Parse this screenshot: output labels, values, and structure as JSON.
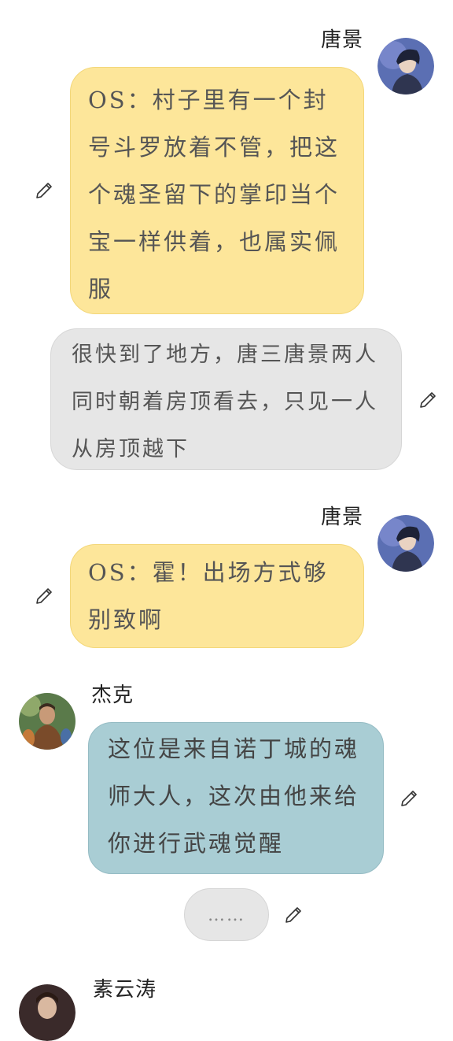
{
  "messages": [
    {
      "speaker": "唐景",
      "text": "OS：村子里有一个封号斗罗放着不管，把这个魂圣留下的掌印当个宝一样供着，也属实佩服",
      "style": "thought"
    },
    {
      "speaker": "",
      "text": "很快到了地方，唐三唐景两人同时朝着房顶看去，只见一人从房顶越下",
      "style": "narration"
    },
    {
      "speaker": "唐景",
      "text": "OS：霍！出场方式够别致啊",
      "style": "thought"
    },
    {
      "speaker": "杰克",
      "text": "这位是来自诺丁城的魂师大人，这次由他来给你进行武魂觉醒",
      "style": "dialogue"
    },
    {
      "speaker": "",
      "text": "……",
      "style": "placeholder"
    },
    {
      "speaker": "素云涛",
      "text": "",
      "style": "dialogue"
    }
  ],
  "icons": {
    "edit": "pencil-icon",
    "avatar": "avatar-image"
  },
  "colors": {
    "thought_bubble": "#fde69a",
    "narration_bubble": "#e6e6e6",
    "dialogue_bubble": "#a9cdd4",
    "background": "#ffffff"
  }
}
